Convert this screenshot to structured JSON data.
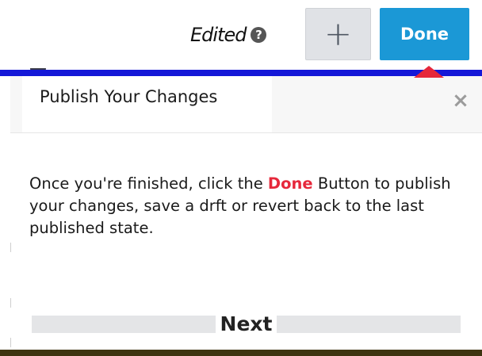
{
  "toolbar": {
    "edited_label": "Edited",
    "help_icon": "question-circle-icon",
    "help_glyph": "?",
    "add_icon": "plus-icon",
    "add_glyph": "+",
    "done_label": "Done"
  },
  "popover": {
    "title": "Publish Your Changes",
    "close_icon": "close-icon",
    "close_glyph": "×",
    "body_before": "Once you're finished, click the ",
    "body_highlight": "Done",
    "body_after": " Button to publish your changes, save a drft or revert back to the last published state.",
    "next_label": "Next"
  },
  "colors": {
    "accent_blue": "#1b98d6",
    "highlight_red": "#e6283b",
    "bar_blue": "#1418d8"
  }
}
